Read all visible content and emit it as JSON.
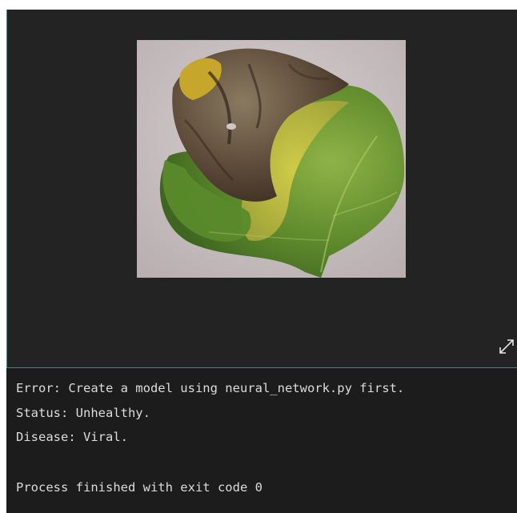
{
  "image_viewer": {
    "image_alt": "Diseased leaf with brown necrotic patch and yellowing",
    "expand_icon": "expand-arrows-icon"
  },
  "console": {
    "lines": [
      "Error: Create a model using neural_network.py first.",
      "Status: Unhealthy.",
      "Disease: Viral.",
      "",
      "Process finished with exit code 0"
    ]
  },
  "colors": {
    "panel_bg": "#232323",
    "console_bg": "#1c1c1c",
    "console_text": "#dcdcdc",
    "panel_border": "#3a8c86"
  }
}
